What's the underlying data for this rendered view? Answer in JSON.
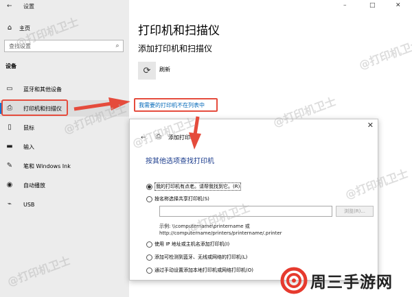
{
  "window": {
    "back_glyph": "←",
    "title": "设置",
    "controls": [
      "–",
      "□",
      "✕"
    ]
  },
  "sidebar": {
    "home_label": "主页",
    "search_placeholder": "查找设置",
    "section_heading": "设备",
    "items": [
      {
        "label": "蓝牙和其他设备",
        "icon": "bluetooth-icon"
      },
      {
        "label": "打印机和扫描仪",
        "icon": "printer-icon",
        "active": true
      },
      {
        "label": "鼠标",
        "icon": "mouse-icon"
      },
      {
        "label": "输入",
        "icon": "keyboard-icon"
      },
      {
        "label": "笔和 Windows Ink",
        "icon": "pen-icon"
      },
      {
        "label": "自动播放",
        "icon": "autoplay-icon"
      },
      {
        "label": "USB",
        "icon": "usb-icon"
      }
    ]
  },
  "main": {
    "title": "打印机和扫描仪",
    "subtitle": "添加打印机和扫描仪",
    "refresh_label": "刷新",
    "missing_printer_link": "我需要的打印机不在列表中"
  },
  "dialog": {
    "close_glyph": "✕",
    "back_glyph": "←",
    "window_title": "添加打印机",
    "heading": "按其他选项查找打印机",
    "options": {
      "old_printer": "我的打印机有点老。请帮我找到它。(R)",
      "by_name": "按名称选择共享打印机(S)",
      "tcpip": "使用 IP 地址或主机名添加打印机(I)",
      "bluetooth": "添加可检测到蓝牙、无线或网络的打印机(L)",
      "manual": "通过手动设置添加本地打印机或网络打印机(O)"
    },
    "share_input_value": "",
    "browse_button": "浏览(R)...",
    "example_line1": "示例: \\\\computername\\printername 或",
    "example_line2": "http://computername/printers/printername/.printer"
  },
  "watermark_text": "@打印机卫士",
  "logo_text": "周三手游网",
  "colors": {
    "accent": "#0078d7",
    "link": "#0067b8",
    "annotation_red": "#e54b3c",
    "dialog_heading": "#1a3b8c"
  }
}
